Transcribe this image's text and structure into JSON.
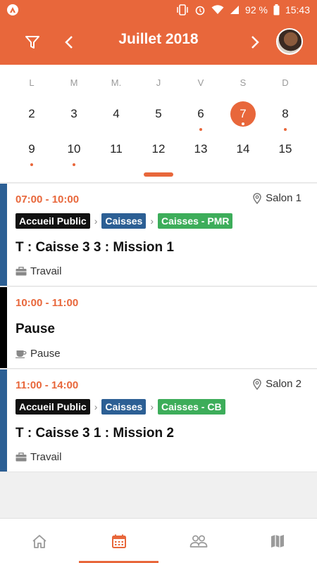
{
  "status_bar": {
    "battery": "92 %",
    "time": "15:43"
  },
  "header": {
    "title": "Juillet 2018"
  },
  "calendar": {
    "weekdays": [
      "L",
      "M",
      "M.",
      "J",
      "V",
      "S",
      "D"
    ],
    "week1": [
      "2",
      "3",
      "4",
      "5",
      "6",
      "7",
      "8"
    ],
    "week2": [
      "9",
      "10",
      "11",
      "12",
      "13",
      "14",
      "15"
    ],
    "selected_day": "7"
  },
  "events": [
    {
      "time": "07:00 - 10:00",
      "location": "Salon 1",
      "tags": [
        "Accueil Public",
        "Caisses",
        "Caisses - PMR"
      ],
      "title": "T : Caisse 3 3 : Mission 1",
      "type": "Travail",
      "bar_color": "#2c5f94"
    },
    {
      "time": "10:00 - 11:00",
      "title": "Pause",
      "type": "Pause",
      "bar_color": "#000000"
    },
    {
      "time": "11:00 - 14:00",
      "location": "Salon 2",
      "tags": [
        "Accueil Public",
        "Caisses",
        "Caisses - CB"
      ],
      "title": "T : Caisse 3 1 : Mission 2",
      "type": "Travail",
      "bar_color": "#2c5f94"
    }
  ],
  "bottom_nav": [
    {
      "icon": "home-icon"
    },
    {
      "icon": "calendar-icon",
      "active": true
    },
    {
      "icon": "people-icon"
    },
    {
      "icon": "map-icon"
    }
  ],
  "colors": {
    "accent": "#e8673b",
    "tag_black": "#111111",
    "tag_blue": "#2c5f94",
    "tag_green": "#3dad5a"
  }
}
